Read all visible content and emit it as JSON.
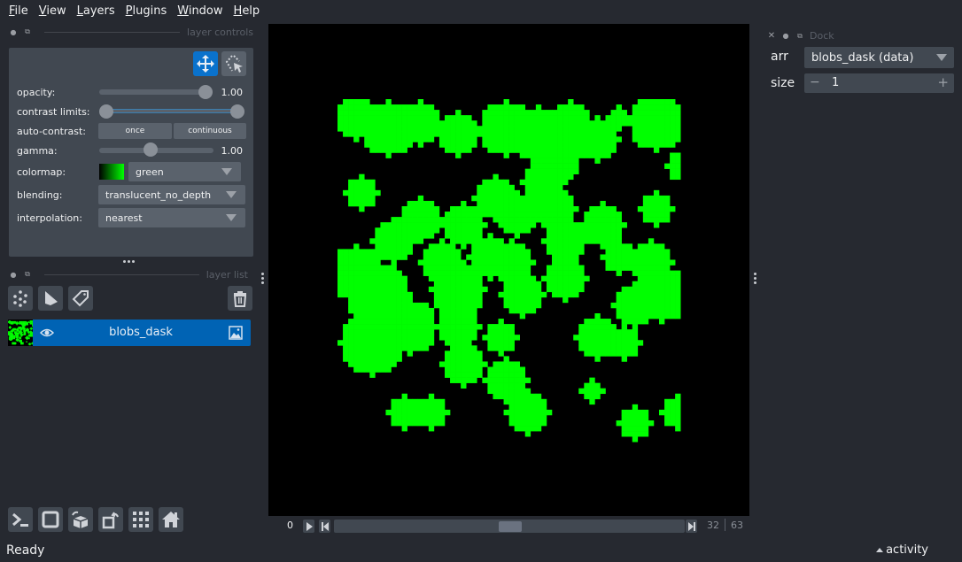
{
  "menubar": {
    "items": [
      {
        "label": "File",
        "mnemonic": "F",
        "rest": "ile"
      },
      {
        "label": "View",
        "mnemonic": "V",
        "rest": "iew"
      },
      {
        "label": "Layers",
        "mnemonic": "L",
        "rest": "ayers"
      },
      {
        "label": "Plugins",
        "mnemonic": "P",
        "rest": "lugins"
      },
      {
        "label": "Window",
        "mnemonic": "W",
        "rest": "indow"
      },
      {
        "label": "Help",
        "mnemonic": "H",
        "rest": "elp"
      }
    ]
  },
  "layer_controls": {
    "title": "layer controls",
    "mode_buttons": [
      {
        "name": "pan-zoom",
        "icon": "move-arrows-icon",
        "active": true
      },
      {
        "name": "transform",
        "icon": "select-transform-icon",
        "active": false
      }
    ],
    "opacity": {
      "label": "opacity:",
      "value": 1.0,
      "display": "1.00"
    },
    "contrast_limits": {
      "label": "contrast limits:",
      "range": [
        0.0,
        1.0
      ]
    },
    "auto_contrast": {
      "label": "auto-contrast:",
      "once": "once",
      "continuous": "continuous"
    },
    "gamma": {
      "label": "gamma:",
      "value": 1.0,
      "display": "1.00",
      "fraction": 0.45
    },
    "colormap": {
      "label": "colormap:",
      "value": "green",
      "color": "#00ff00"
    },
    "blending": {
      "label": "blending:",
      "value": "translucent_no_depth"
    },
    "interpolation": {
      "label": "interpolation:",
      "value": "nearest"
    }
  },
  "layer_list": {
    "title": "layer list",
    "buttons": [
      "new-points-layer",
      "new-shapes-layer",
      "new-labels-layer"
    ],
    "delete_button": "delete-layer",
    "layers": [
      {
        "name": "blobs_dask",
        "visible": true,
        "type": "image",
        "selected": true
      }
    ]
  },
  "viewer_buttons": [
    "console",
    "ndisplay-2d",
    "roll-dims-3d",
    "transpose",
    "grid",
    "home"
  ],
  "dims": {
    "current": "0",
    "slider_value": 32,
    "slider_max": 63,
    "fraction": 0.508
  },
  "right_dock": {
    "title": "Dock",
    "arr_label": "arr",
    "arr_value": "blobs_dask (data)",
    "size_label": "size",
    "size_value": "1",
    "minus": "−",
    "plus": "+"
  },
  "status": {
    "text": "Ready",
    "activity": "activity"
  },
  "colors": {
    "accent": "#0a72cc",
    "layer_selected": "#0063b4",
    "blob_green": "#00ff00",
    "background": "#262930",
    "panel": "#414851"
  },
  "canvas": {
    "image_name": "blobs_dask",
    "grid_size": 64,
    "blob_rows": [
      "1111....1111.............111111....111111111.....1111",
      "11111..1111111...........1111111..1111111111111...111",
      "111111111111.....111.....1111111111111111111111...111",
      "11111111111.....11111......111111111111111111111111...",
      "11.11111111111..111111.....11111...11111111111111....",
      "11..111111111111111111.....111111..1111111.1111111...",
      "...111111111111111111111...11111...1111.1111111111..1",
      "...1111111111111111111111..111111..11111111111111...1",
      "....111111111111111111111111111111...11111111111111..",
      "....11111111...111111111111111111...1111111111111...",
      "......11111.......111111111111111....11111111111.....",
      "11.......................11111..........1111111111...",
      "11.......................1111..........11111111111...",
      "........................................11111.....111",
      ".........11111...........................1111.....111",
      "........11111111.....1111...........11111111111...111",
      "........111111111...11111111.1111111111111111......",
      ".........11111111...1111111111111111111111111.......",
      "........11111.......11111111111111111111111111......",
      "........1111..........111111111111111111111111111....."
    ]
  }
}
